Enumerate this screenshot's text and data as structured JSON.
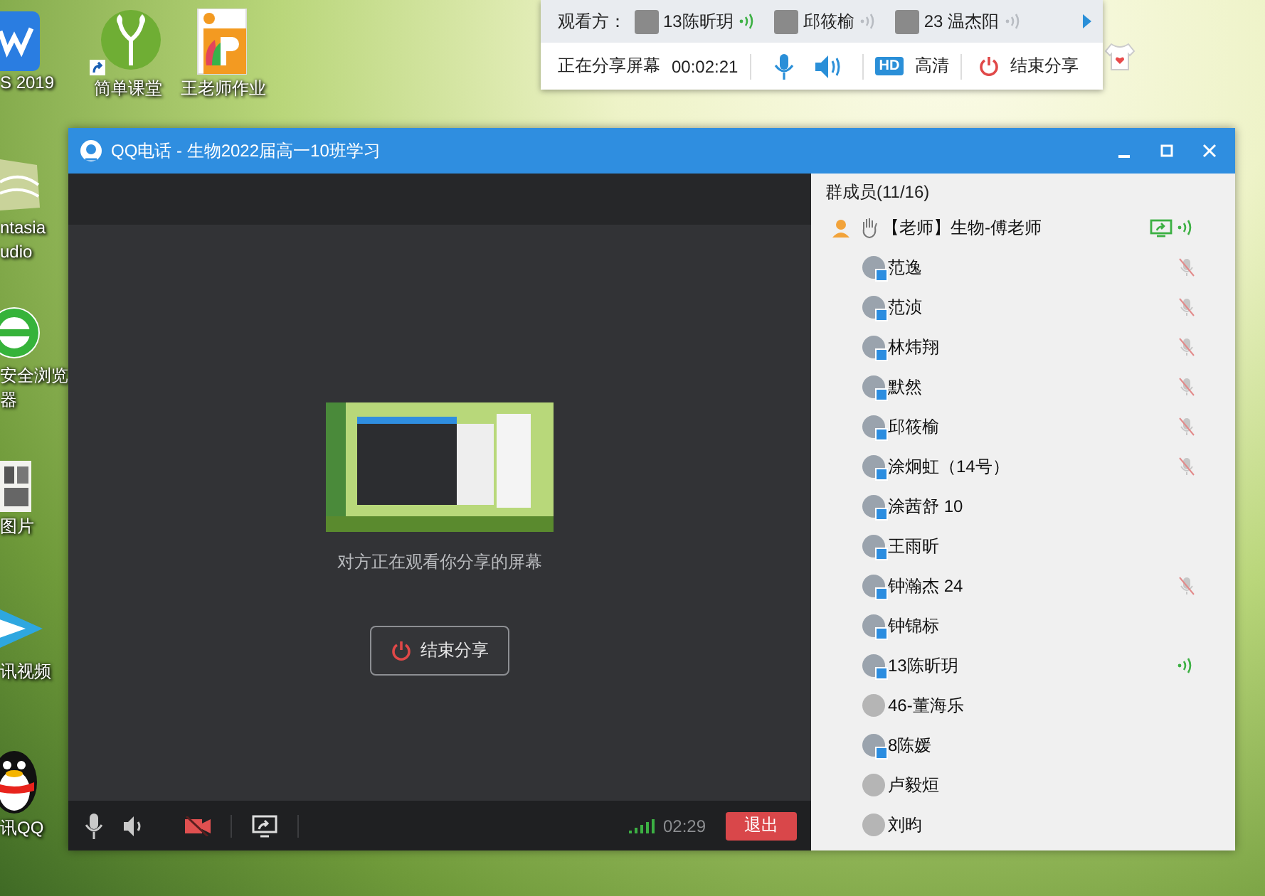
{
  "desktop_icons": [
    {
      "kind": "wps",
      "label": [
        "S 2019"
      ]
    },
    {
      "kind": "camtasia",
      "label": [
        "ntasia",
        "udio"
      ]
    },
    {
      "kind": "browser",
      "label": [
        "安全浏览",
        "器"
      ]
    },
    {
      "kind": "photos",
      "label": [
        "图片"
      ]
    },
    {
      "kind": "video",
      "label": [
        "讯视频"
      ]
    },
    {
      "kind": "qq",
      "label": [
        "讯QQ"
      ]
    },
    {
      "kind": "sprout",
      "label": [
        "简单课堂"
      ],
      "shortcut": true
    },
    {
      "kind": "slides",
      "label": [
        "王老师作业"
      ],
      "shortcut": false
    }
  ],
  "share_bar": {
    "viewers_label": "观看方：",
    "viewers": [
      {
        "name": "13陈昕玥",
        "speaking": true
      },
      {
        "name": "邱筱榆",
        "speaking": false
      },
      {
        "name": "23 温杰阳",
        "speaking": false
      }
    ],
    "status": "正在分享屏幕",
    "timer": "00:02:21",
    "hd_badge": "HD",
    "quality": "高清",
    "end_button": "结束分享"
  },
  "window": {
    "title": "QQ电话 - 生物2022届高一10班学习",
    "share_notice": "对方正在观看你分享的屏幕",
    "end_share_button": "结束分享",
    "toolbar": {
      "camera_off": true,
      "duration": "02:29",
      "exit_button": "退出"
    },
    "members_header": "群成员(11/16)",
    "members": [
      {
        "kind": "teacher",
        "name": "【老师】生物-傅老师",
        "muted": false,
        "speaking": true
      },
      {
        "kind": "member",
        "name": "范逸",
        "muted": true,
        "speaking": false,
        "device_badge": true
      },
      {
        "kind": "member",
        "name": "范浈",
        "muted": true,
        "speaking": false,
        "device_badge": true
      },
      {
        "kind": "member",
        "name": "林炜翔",
        "muted": true,
        "speaking": false,
        "device_badge": true
      },
      {
        "kind": "member",
        "name": "默然",
        "muted": true,
        "speaking": false,
        "device_badge": true
      },
      {
        "kind": "member",
        "name": "邱筱榆",
        "muted": true,
        "speaking": false,
        "device_badge": true
      },
      {
        "kind": "member",
        "name": "涂炯虹（14号）",
        "muted": true,
        "speaking": false,
        "device_badge": true
      },
      {
        "kind": "member",
        "name": "涂茜舒 10",
        "muted": false,
        "speaking": false,
        "device_badge": true
      },
      {
        "kind": "member",
        "name": "王雨昕",
        "muted": false,
        "speaking": false,
        "device_badge": true
      },
      {
        "kind": "member",
        "name": "钟瀚杰 24",
        "muted": true,
        "speaking": false,
        "device_badge": true
      },
      {
        "kind": "member",
        "name": "钟锦标",
        "muted": false,
        "speaking": false,
        "device_badge": true
      },
      {
        "kind": "member",
        "name": "13陈昕玥",
        "muted": false,
        "speaking": true,
        "device_badge": true
      },
      {
        "kind": "member",
        "name": "46-董海乐",
        "muted": false,
        "speaking": false,
        "device_badge": false
      },
      {
        "kind": "member",
        "name": "8陈媛",
        "muted": false,
        "speaking": false,
        "device_badge": true
      },
      {
        "kind": "member",
        "name": "卢毅烜",
        "muted": false,
        "speaking": false,
        "device_badge": false
      },
      {
        "kind": "member",
        "name": "刘昀",
        "muted": false,
        "speaking": false,
        "device_badge": false
      }
    ]
  }
}
